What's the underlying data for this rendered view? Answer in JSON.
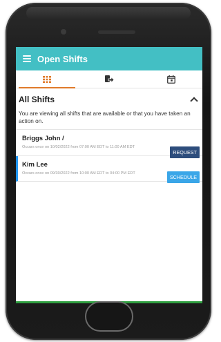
{
  "appbar": {
    "title": "Open Shifts"
  },
  "tabs": [
    {
      "icon": "grid-icon",
      "active": true
    },
    {
      "icon": "swap-shift-icon",
      "active": false
    },
    {
      "icon": "calendar-icon",
      "active": false
    }
  ],
  "section": {
    "title": "All Shifts",
    "info": "You are viewing all shifts that are available or that you have taken an action on."
  },
  "shifts": [
    {
      "name": "Briggs John /",
      "description": "Occurs once on 10/02/2022 from 07:00 AM EDT to 11:00 AM EDT",
      "action": "REQUEST"
    },
    {
      "name": "Kim Lee",
      "description": "Occurs once on 09/30/2022 from 10:00 AM EDT to 04:00 PM EDT",
      "action": "SCHEDULE"
    }
  ],
  "colors": {
    "appbar": "#43bfc4",
    "tab_indicator": "#e07a2a",
    "request_button": "#2d4d7c",
    "schedule_button": "#3aa6e8",
    "accent_border": "#2196f3"
  }
}
